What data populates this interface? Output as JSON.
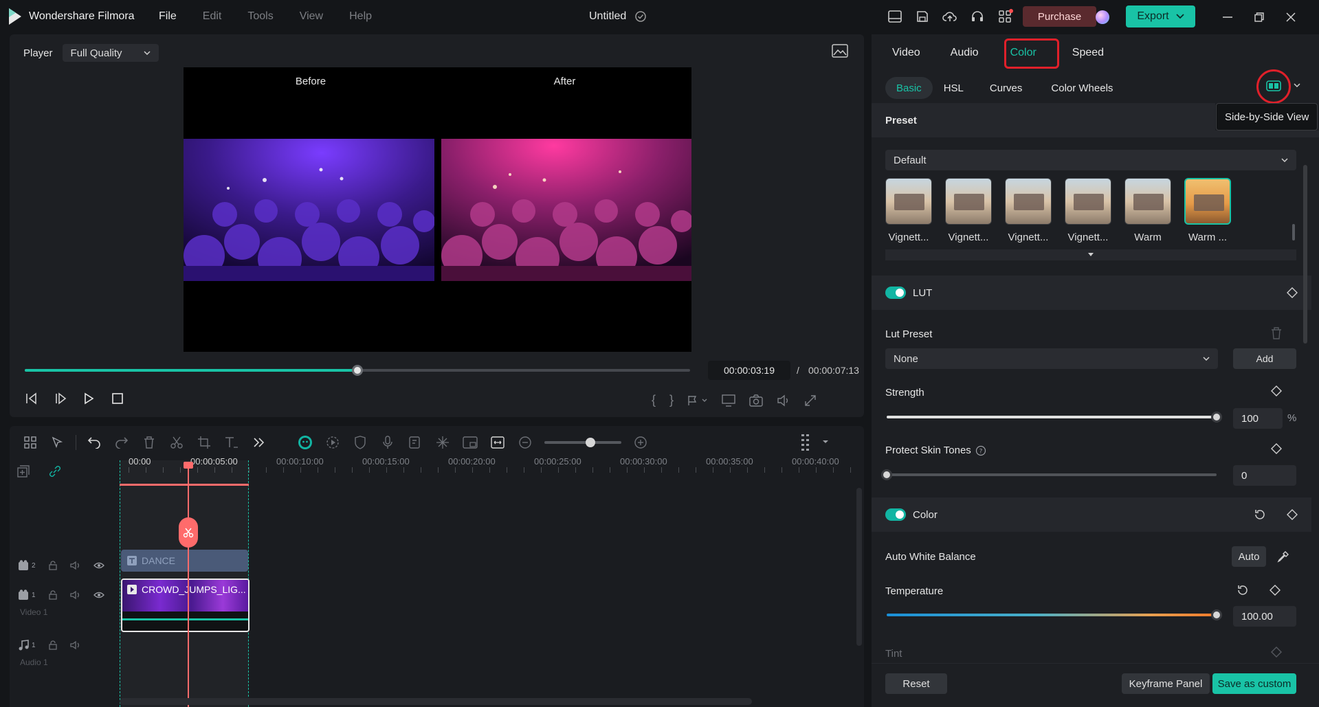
{
  "app": {
    "name": "Wondershare Filmora",
    "title": "Untitled",
    "menu": [
      "File",
      "Edit",
      "Tools",
      "View",
      "Help"
    ],
    "purchase": "Purchase",
    "export": "Export"
  },
  "player": {
    "label": "Player",
    "quality": "Full Quality",
    "before": "Before",
    "after": "After",
    "current_time": "00:00:03:19",
    "separator": "/",
    "total_time": "00:00:07:13",
    "progress": 0.5
  },
  "timeline": {
    "ruler": [
      "00:00",
      "00:00:05:00",
      "00:00:10:00",
      "00:00:15:00",
      "00:00:20:00",
      "00:00:25:00",
      "00:00:30:00",
      "00:00:35:00",
      "00:00:40:00"
    ],
    "tracks": {
      "t2_num": "2",
      "v1_num": "1",
      "v1_label": "Video 1",
      "a1_num": "1",
      "a1_label": "Audio 1"
    },
    "title_clip": "DANCE",
    "video_clip": "CROWD_JUMPS_LIG..."
  },
  "panel": {
    "tabs": [
      "Video",
      "Audio",
      "Color",
      "Speed"
    ],
    "active_tab": "Color",
    "subtabs": [
      "Basic",
      "HSL",
      "Curves",
      "Color Wheels"
    ],
    "tooltip": "Side-by-Side View",
    "preset": {
      "title": "Preset",
      "selected": "Default",
      "items": [
        "Vignett...",
        "Vignett...",
        "Vignett...",
        "Vignett...",
        "Warm",
        "Warm ..."
      ]
    },
    "lut": {
      "title": "LUT",
      "preset_label": "Lut Preset",
      "preset_value": "None",
      "add": "Add",
      "strength_label": "Strength",
      "strength_value": "100",
      "strength_unit": "%",
      "strength_level": 1.0,
      "skin_label": "Protect Skin Tones",
      "skin_value": "0",
      "skin_level": 0.0
    },
    "color": {
      "title": "Color",
      "awb_label": "Auto White Balance",
      "auto": "Auto",
      "temperature_label": "Temperature",
      "temperature_value": "100.00",
      "temperature_level": 1.0,
      "tint_label": "Tint"
    },
    "footer": {
      "reset": "Reset",
      "keyframe": "Keyframe Panel",
      "save": "Save as custom"
    }
  },
  "colors": {
    "accent": "#12b5a3",
    "playhead": "#ff6b6b",
    "purchase_bg": "#5a2a2e",
    "highlight": "#e0202a"
  }
}
